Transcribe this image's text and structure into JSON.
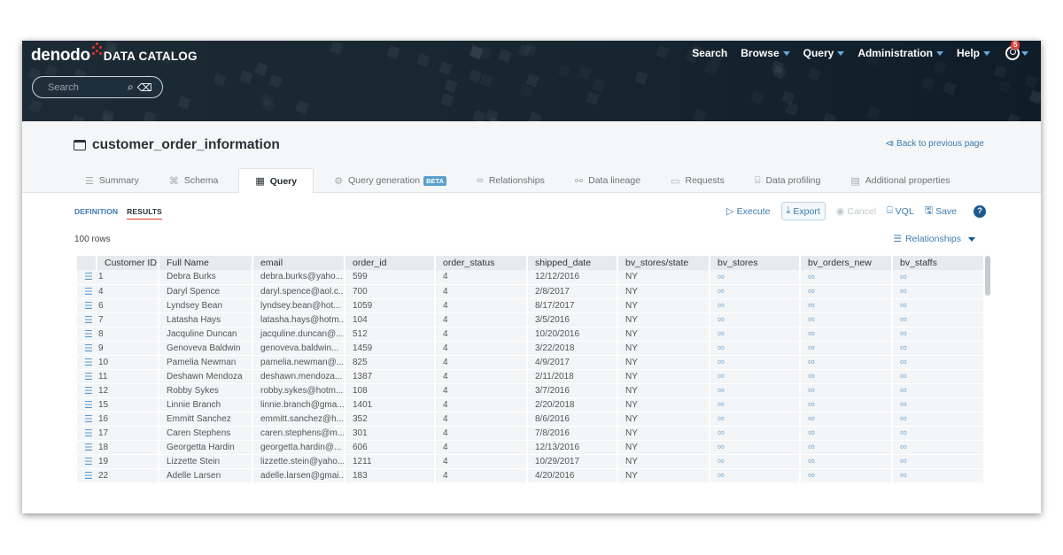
{
  "header": {
    "brand": "denodo",
    "product": "DATA CATALOG",
    "search_placeholder": "Search",
    "nav": [
      {
        "label": "Search",
        "dropdown": false
      },
      {
        "label": "Browse",
        "dropdown": true
      },
      {
        "label": "Query",
        "dropdown": true
      },
      {
        "label": "Administration",
        "dropdown": true
      },
      {
        "label": "Help",
        "dropdown": true
      }
    ],
    "notification_count": "5"
  },
  "page": {
    "title": "customer_order_information",
    "back_link": "Back to previous page",
    "tabs": [
      {
        "label": "Summary",
        "icon": "list-icon",
        "glyph": "☰"
      },
      {
        "label": "Schema",
        "icon": "schema-icon",
        "glyph": "⌘"
      },
      {
        "label": "Query",
        "icon": "table-icon",
        "glyph": "▦",
        "active": true
      },
      {
        "label": "Query generation",
        "icon": "ai-chip-icon",
        "glyph": "⚙",
        "badge": "BETA"
      },
      {
        "label": "Relationships",
        "icon": "link-icon",
        "glyph": "∞"
      },
      {
        "label": "Data lineage",
        "icon": "lineage-icon",
        "glyph": "⚯"
      },
      {
        "label": "Requests",
        "icon": "comment-icon",
        "glyph": "▭"
      },
      {
        "label": "Data profiling",
        "icon": "bar-chart-icon",
        "glyph": "⌸"
      },
      {
        "label": "Additional properties",
        "icon": "clipboard-icon",
        "glyph": "▤"
      }
    ]
  },
  "query": {
    "subtabs": [
      {
        "label": "DEFINITION",
        "active": false
      },
      {
        "label": "RESULTS",
        "active": true
      }
    ],
    "actions": {
      "execute": "Execute",
      "export": "Export",
      "cancel": "Cancel",
      "vql": "VQL",
      "save": "Save",
      "help": "?"
    },
    "row_count": "100 rows",
    "relationships_dropdown": "Relationships"
  },
  "results": {
    "columns": [
      "Customer ID",
      "Full Name",
      "email",
      "order_id",
      "order_status",
      "shipped_date",
      "bv_stores/state",
      "bv_stores",
      "bv_orders_new",
      "bv_staffs"
    ],
    "rows": [
      [
        "1",
        "Debra Burks",
        "debra.burks@yaho...",
        "599",
        "4",
        "12/12/2016",
        "NY"
      ],
      [
        "4",
        "Daryl Spence",
        "daryl.spence@aol.c...",
        "700",
        "4",
        "2/8/2017",
        "NY"
      ],
      [
        "6",
        "Lyndsey Bean",
        "lyndsey.bean@hot...",
        "1059",
        "4",
        "8/17/2017",
        "NY"
      ],
      [
        "7",
        "Latasha Hays",
        "latasha.hays@hotm...",
        "104",
        "4",
        "3/5/2016",
        "NY"
      ],
      [
        "8",
        "Jacquline Duncan",
        "jacquline.duncan@...",
        "512",
        "4",
        "10/20/2016",
        "NY"
      ],
      [
        "9",
        "Genoveva Baldwin",
        "genoveva.baldwin...",
        "1459",
        "4",
        "3/22/2018",
        "NY"
      ],
      [
        "10",
        "Pamelia Newman",
        "pamelia.newman@...",
        "825",
        "4",
        "4/9/2017",
        "NY"
      ],
      [
        "11",
        "Deshawn Mendoza",
        "deshawn.mendoza...",
        "1387",
        "4",
        "2/11/2018",
        "NY"
      ],
      [
        "12",
        "Robby Sykes",
        "robby.sykes@hotm...",
        "108",
        "4",
        "3/7/2016",
        "NY"
      ],
      [
        "15",
        "Linnie Branch",
        "linnie.branch@gma...",
        "1401",
        "4",
        "2/20/2018",
        "NY"
      ],
      [
        "16",
        "Emmitt Sanchez",
        "emmitt.sanchez@h...",
        "352",
        "4",
        "8/6/2016",
        "NY"
      ],
      [
        "17",
        "Caren Stephens",
        "caren.stephens@m...",
        "301",
        "4",
        "7/8/2016",
        "NY"
      ],
      [
        "18",
        "Georgetta Hardin",
        "georgetta.hardin@...",
        "606",
        "4",
        "12/13/2016",
        "NY"
      ],
      [
        "19",
        "Lizzette Stein",
        "lizzette.stein@yaho...",
        "1211",
        "4",
        "10/29/2017",
        "NY"
      ],
      [
        "22",
        "Adelle Larsen",
        "adelle.larsen@gmai...",
        "183",
        "4",
        "4/20/2016",
        "NY"
      ]
    ],
    "link_columns": [
      "bv_stores",
      "bv_orders_new",
      "bv_staffs"
    ]
  }
}
